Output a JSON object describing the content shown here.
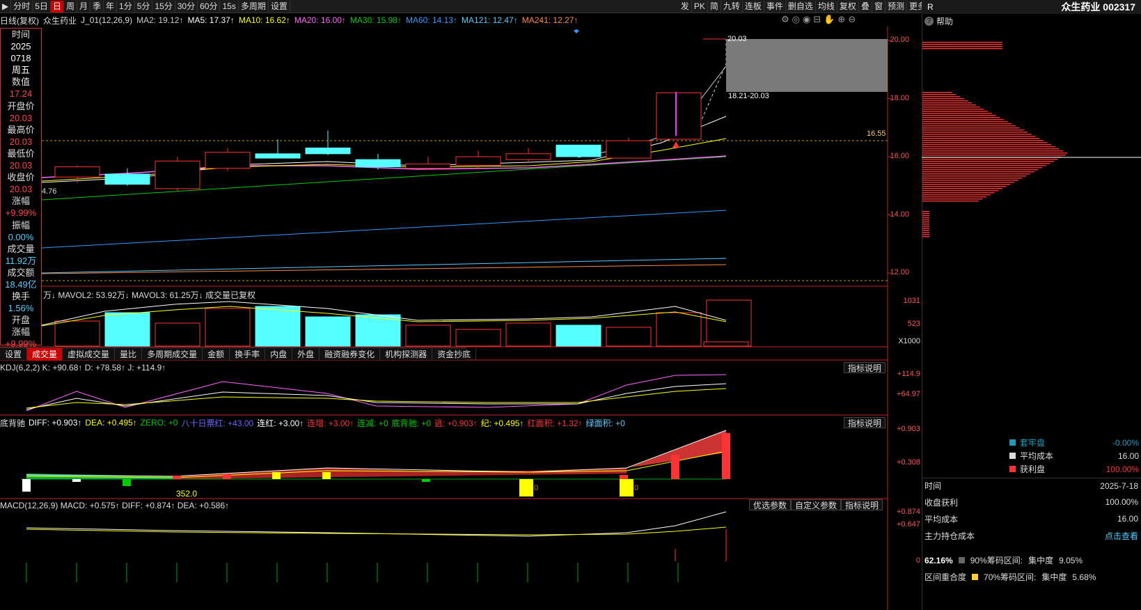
{
  "toolbar": {
    "left_items": [
      "分时",
      "5日",
      "日",
      "周",
      "月",
      "季",
      "年",
      "1分",
      "5分",
      "15分",
      "30分",
      "60分",
      "15s",
      "多周期",
      "设置"
    ],
    "active": "日",
    "right_items": [
      "发",
      "PK",
      "简",
      "九转",
      "连板",
      "事件",
      "删自选",
      "均线",
      "复权",
      "叠",
      "窗",
      "预测",
      "更多"
    ]
  },
  "header": {
    "title": "日线(复权)",
    "name": "众生药业",
    "indicator": "J_01(12,26,9)",
    "ma2": "MA2: 19.12↑",
    "ma5": "MA5: 17.37↑",
    "ma10": "MA10: 16.62↑",
    "ma20": "MA20: 16.00↑",
    "ma30": "MA30: 15.98↑",
    "ma60": "MA60: 14.13↑",
    "ma121": "MA121: 12.47↑",
    "ma241": "MA241: 12.27↑"
  },
  "info_panel": [
    {
      "label": "时间",
      "value": "2025",
      "cls": "white"
    },
    {
      "label": "",
      "value": "0718",
      "cls": "white"
    },
    {
      "label": "",
      "value": "周五",
      "cls": "white"
    },
    {
      "label": "数值",
      "value": "17.24",
      "cls": ""
    },
    {
      "label": "开盘价",
      "value": "20.03",
      "cls": ""
    },
    {
      "label": "最高价",
      "value": "20.03",
      "cls": ""
    },
    {
      "label": "最低价",
      "value": "20.03",
      "cls": ""
    },
    {
      "label": "收盘价",
      "value": "20.03",
      "cls": ""
    },
    {
      "label": "涨幅",
      "value": "+9.99%",
      "cls": ""
    },
    {
      "label": "振幅",
      "value": "0.00%",
      "cls": "cyan"
    },
    {
      "label": "成交量",
      "value": "11.92万",
      "cls": "cyan"
    },
    {
      "label": "成交额",
      "value": "18.49亿",
      "cls": "cyan"
    },
    {
      "label": "换手",
      "value": "1.56%",
      "cls": "cyan"
    },
    {
      "label": "开盘",
      "value": "",
      "cls": ""
    },
    {
      "label": "涨幅",
      "value": "+9.99%",
      "cls": ""
    }
  ],
  "price_axis": [
    "20.00",
    "18.00",
    "16.00",
    "14.00",
    "12.00"
  ],
  "annotations": {
    "top": "20.03",
    "range": "18.21-20.03",
    "level": "16.55",
    "low": "4.76"
  },
  "volume": {
    "header": "万↓ MAVOL2: 53.92万↓ MAVOL3: 61.25万↓  成交量已复权",
    "axis": [
      "1031",
      "523",
      "X1000"
    ]
  },
  "tabs": [
    "设置",
    "成交量",
    "虚拟成交量",
    "量比",
    "多周期成交量",
    "金额",
    "换手率",
    "内盘",
    "外盘",
    "融资融券变化",
    "机构探测器",
    "资金抄底"
  ],
  "active_tab": "成交量",
  "kdj": {
    "header": "KDJ(6,2,2) K: +90.68↑ D: +78.58↑ J: +114.9↑",
    "axis": [
      "+114.9",
      "+64.97"
    ],
    "btn": "指标说明"
  },
  "dbc": {
    "title": "底背驰",
    "items": [
      {
        "t": "DIFF: +0.903↑",
        "c": "#fff"
      },
      {
        "t": "DEA: +0.495↑",
        "c": "#ff0"
      },
      {
        "t": "ZERO: +0",
        "c": "#0c0"
      },
      {
        "t": "八十日票红: +43.00",
        "c": "#66f"
      },
      {
        "t": "连红: +3.00↑",
        "c": "#fff"
      },
      {
        "t": "连增: +3.00↑",
        "c": "#f33"
      },
      {
        "t": "连减: +0",
        "c": "#0c0"
      },
      {
        "t": "底背驰: +0",
        "c": "#0c0"
      },
      {
        "t": "逃: +0.903↑",
        "c": "#f33"
      },
      {
        "t": "纪: +0.495↑",
        "c": "#ff0"
      },
      {
        "t": "红面积: +1.32↑",
        "c": "#f33"
      },
      {
        "t": "绿面积: +0",
        "c": "#5cf"
      }
    ],
    "axis": [
      "+0.903",
      "+0.308"
    ],
    "btn": "指标说明",
    "label352": "352.0",
    "mark_labels": [
      "0",
      "0"
    ]
  },
  "macd": {
    "header": "MACD(12,26,9) MACD: +0.575↑ DIFF: +0.874↑ DEA: +0.586↑",
    "axis": [
      "+0.874",
      "+0.647",
      "0"
    ],
    "btns": [
      "优选参数",
      "自定义参数",
      "指标说明"
    ]
  },
  "right_panel": {
    "r": "R",
    "title": "众生药业 002317",
    "help": "帮助",
    "legend": [
      {
        "label": "套牢盘",
        "value": "-0.00%",
        "color": "#29b"
      },
      {
        "label": "平均成本",
        "value": "16.00",
        "color": "#ddd"
      },
      {
        "label": "获利盘",
        "value": "100.00%",
        "color": "#f33"
      }
    ],
    "rows": [
      {
        "label": "时间",
        "value": "2025-7-18"
      },
      {
        "label": "收盘获利",
        "value": "100.00%"
      },
      {
        "label": "平均成本",
        "value": "16.00"
      },
      {
        "label": "主力持仓成本",
        "value": "点击查看"
      }
    ],
    "conc1": {
      "pct": "62.16%",
      "label": "90%筹码区间:",
      "c": "集中度",
      "v": "9.05%"
    },
    "conc2": {
      "pct": "区间重合度",
      "label": "70%筹码区间:",
      "c": "集中度",
      "v": "5.68%"
    }
  },
  "chart_data": {
    "type": "candlestick",
    "candles": [
      {
        "o": 15.3,
        "h": 15.7,
        "l": 15.1,
        "c": 15.65,
        "up": true
      },
      {
        "o": 15.4,
        "h": 15.6,
        "l": 15.0,
        "c": 15.05,
        "up": false
      },
      {
        "o": 14.9,
        "h": 16.0,
        "l": 14.8,
        "c": 15.85,
        "up": true
      },
      {
        "o": 15.6,
        "h": 16.3,
        "l": 15.5,
        "c": 16.15,
        "up": true
      },
      {
        "o": 16.1,
        "h": 16.6,
        "l": 15.95,
        "c": 15.95,
        "up": false
      },
      {
        "o": 16.3,
        "h": 16.9,
        "l": 16.05,
        "c": 16.1,
        "up": false
      },
      {
        "o": 15.9,
        "h": 16.1,
        "l": 15.55,
        "c": 15.65,
        "up": false
      },
      {
        "o": 15.6,
        "h": 16.0,
        "l": 15.55,
        "c": 15.75,
        "up": true
      },
      {
        "o": 15.7,
        "h": 16.2,
        "l": 15.6,
        "c": 16.0,
        "up": true
      },
      {
        "o": 15.9,
        "h": 16.3,
        "l": 15.8,
        "c": 16.1,
        "up": true
      },
      {
        "o": 16.4,
        "h": 16.4,
        "l": 16.0,
        "c": 16.0,
        "up": false
      },
      {
        "o": 15.95,
        "h": 16.65,
        "l": 15.95,
        "c": 16.55,
        "up": true
      },
      {
        "o": 16.6,
        "h": 18.2,
        "l": 16.6,
        "c": 18.2,
        "up": true
      },
      {
        "o": 20.03,
        "h": 20.03,
        "l": 20.03,
        "c": 20.03,
        "up": true
      }
    ],
    "volumes": [
      60,
      80,
      55,
      90,
      95,
      70,
      75,
      50,
      40,
      55,
      50,
      45,
      80,
      110,
      10
    ],
    "ylim": [
      11.5,
      20.5
    ]
  }
}
